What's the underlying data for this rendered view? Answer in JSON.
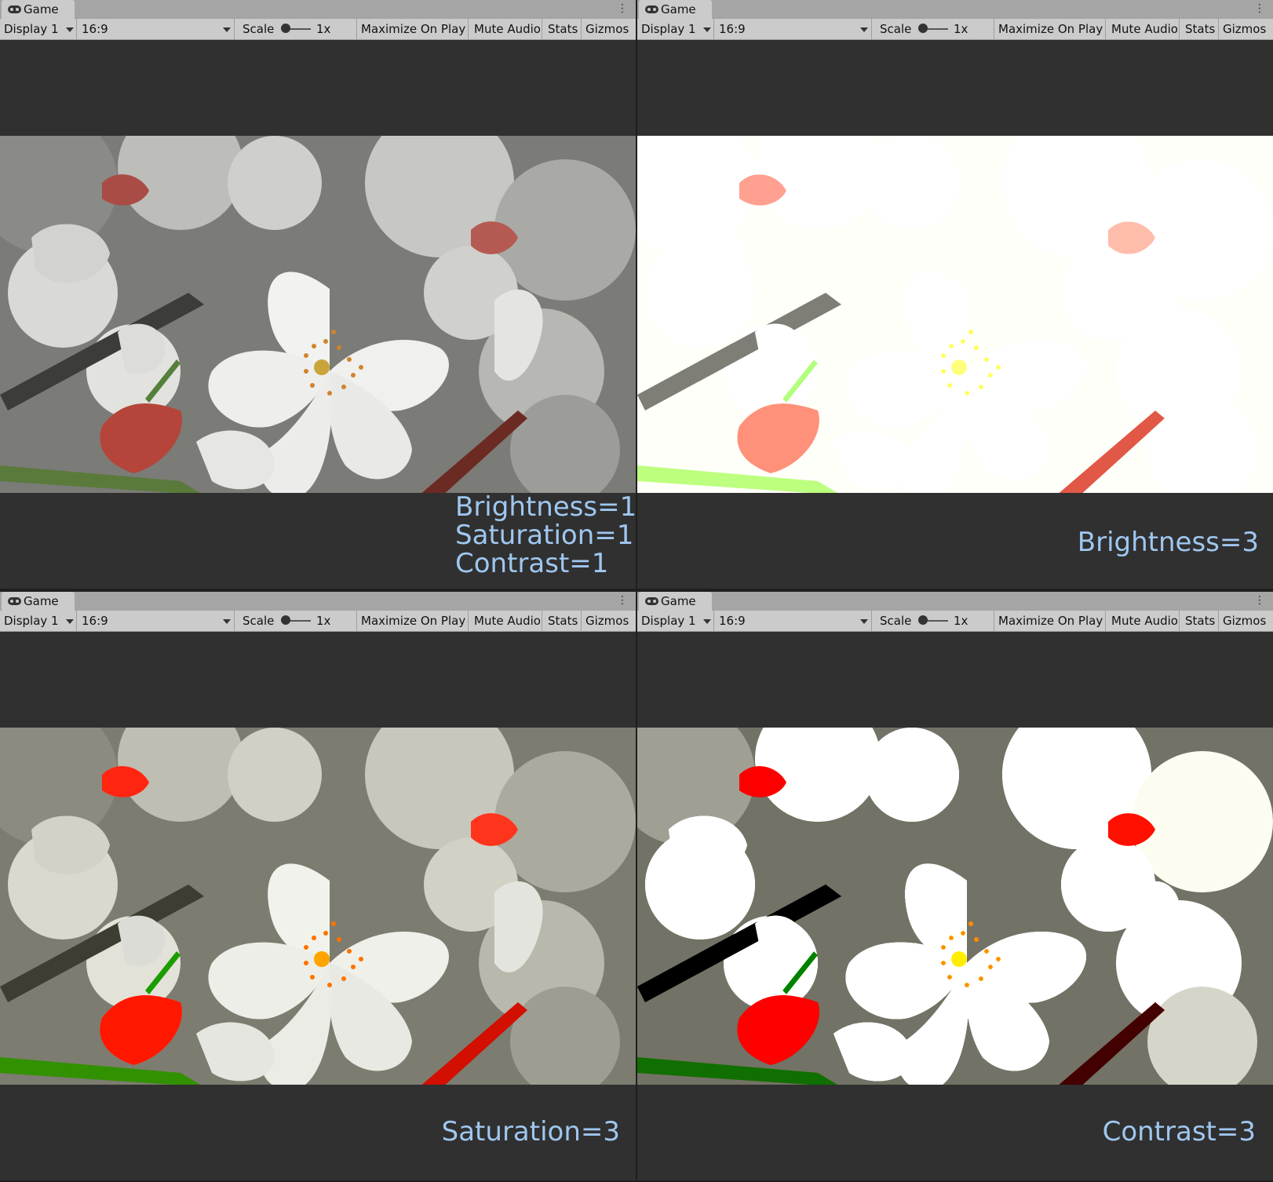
{
  "panels": [
    {
      "tab_title": "Game",
      "display": "Display 1",
      "aspect": "16:9",
      "scale_label": "Scale",
      "scale_value": "1x",
      "maximize_on_play": "Maximize On Play",
      "mute_audio": "Mute Audio",
      "stats": "Stats",
      "gizmos": "Gizmos",
      "caption_lines": [
        "Brightness=1",
        "Saturation=1",
        "Contrast=1"
      ]
    },
    {
      "tab_title": "Game",
      "display": "Display 1",
      "aspect": "16:9",
      "scale_label": "Scale",
      "scale_value": "1x",
      "maximize_on_play": "Maximize On Play",
      "mute_audio": "Mute Audio",
      "stats": "Stats",
      "gizmos": "Gizmos",
      "caption": "Brightness=3"
    },
    {
      "tab_title": "Game",
      "display": "Display 1",
      "aspect": "16:9",
      "scale_label": "Scale",
      "scale_value": "1x",
      "maximize_on_play": "Maximize On Play",
      "mute_audio": "Mute Audio",
      "stats": "Stats",
      "gizmos": "Gizmos",
      "caption": "Saturation=3"
    },
    {
      "tab_title": "Game",
      "display": "Display 1",
      "aspect": "16:9",
      "scale_label": "Scale",
      "scale_value": "1x",
      "maximize_on_play": "Maximize On Play",
      "mute_audio": "Mute Audio",
      "stats": "Stats",
      "gizmos": "Gizmos",
      "caption": "Contrast=3"
    }
  ],
  "colors": {
    "caption_text": "#9fc7f0",
    "viewport_bg": "#303030",
    "toolbar_bg": "#cbcbcb"
  },
  "icons": {
    "tab": "gamepad-icon",
    "dropdown": "chevron-down-icon",
    "menu": "kebab-menu-icon"
  }
}
